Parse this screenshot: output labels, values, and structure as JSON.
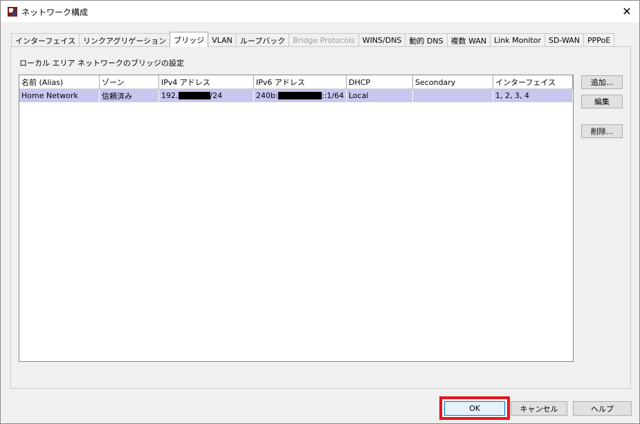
{
  "window": {
    "title": "ネットワーク構成",
    "close_glyph": "✕"
  },
  "tabs": [
    {
      "label": "インターフェイス",
      "state": "normal"
    },
    {
      "label": "リンクアグリゲーション",
      "state": "normal"
    },
    {
      "label": "ブリッジ",
      "state": "active"
    },
    {
      "label": "VLAN",
      "state": "normal"
    },
    {
      "label": "ループバック",
      "state": "normal"
    },
    {
      "label": "Bridge Protocols",
      "state": "disabled"
    },
    {
      "label": "WINS/DNS",
      "state": "normal"
    },
    {
      "label": "動的 DNS",
      "state": "normal"
    },
    {
      "label": "複数 WAN",
      "state": "normal"
    },
    {
      "label": "Link Monitor",
      "state": "normal"
    },
    {
      "label": "SD-WAN",
      "state": "normal"
    },
    {
      "label": "PPPoE",
      "state": "normal"
    }
  ],
  "panel": {
    "section_label": "ローカル エリア ネットワークのブリッジの設定"
  },
  "table": {
    "columns": [
      "名前 (Alias)",
      "ゾーン",
      "IPv4 アドレス",
      "IPv6 アドレス",
      "DHCP",
      "Secondary",
      "インターフェイス"
    ],
    "rows": [
      {
        "name": "Home Network",
        "zone": "信頼済み",
        "ipv4_prefix": "192.",
        "ipv4_suffix": "/24",
        "ipv6_prefix": "240b:",
        "ipv6_suffix": "::1/64",
        "dhcp": "Local",
        "secondary": "",
        "interfaces": "1, 2, 3, 4"
      }
    ]
  },
  "side_buttons": {
    "add": "追加...",
    "edit": "編集",
    "delete": "削除..."
  },
  "bottom_buttons": {
    "ok": "OK",
    "cancel": "キャンセル",
    "help": "ヘルプ"
  },
  "colors": {
    "selected_row": "#c9c6f0",
    "highlight_box": "#e8141c"
  }
}
